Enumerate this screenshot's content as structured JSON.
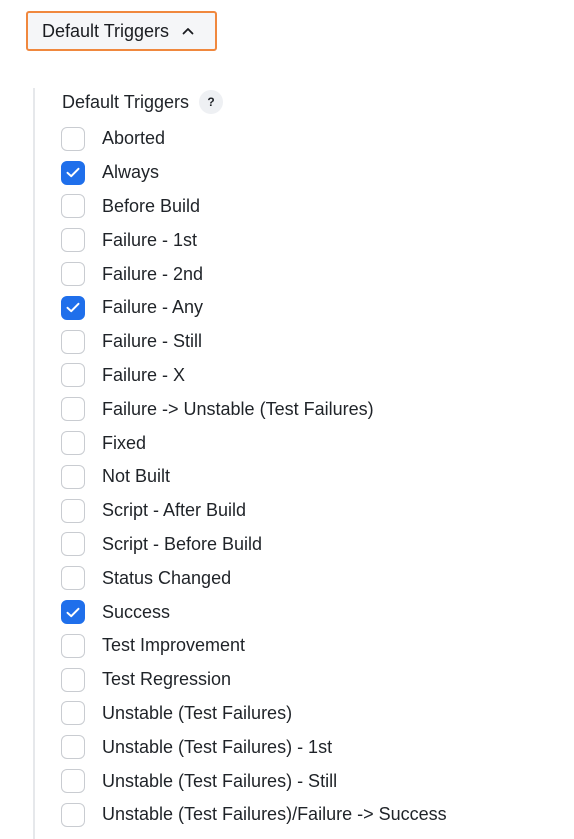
{
  "toggle": {
    "label": "Default Triggers",
    "expanded": true
  },
  "section": {
    "title": "Default Triggers",
    "help_label": "?"
  },
  "triggers": [
    {
      "label": "Aborted",
      "checked": false
    },
    {
      "label": "Always",
      "checked": true
    },
    {
      "label": "Before Build",
      "checked": false
    },
    {
      "label": "Failure - 1st",
      "checked": false
    },
    {
      "label": "Failure - 2nd",
      "checked": false
    },
    {
      "label": "Failure - Any",
      "checked": true
    },
    {
      "label": "Failure - Still",
      "checked": false
    },
    {
      "label": "Failure - X",
      "checked": false
    },
    {
      "label": "Failure -> Unstable (Test Failures)",
      "checked": false
    },
    {
      "label": "Fixed",
      "checked": false
    },
    {
      "label": "Not Built",
      "checked": false
    },
    {
      "label": "Script - After Build",
      "checked": false
    },
    {
      "label": "Script - Before Build",
      "checked": false
    },
    {
      "label": "Status Changed",
      "checked": false
    },
    {
      "label": "Success",
      "checked": true
    },
    {
      "label": "Test Improvement",
      "checked": false
    },
    {
      "label": "Test Regression",
      "checked": false
    },
    {
      "label": "Unstable (Test Failures)",
      "checked": false
    },
    {
      "label": "Unstable (Test Failures) - 1st",
      "checked": false
    },
    {
      "label": "Unstable (Test Failures) - Still",
      "checked": false
    },
    {
      "label": "Unstable (Test Failures)/Failure -> Success",
      "checked": false
    }
  ],
  "colors": {
    "focus_outline": "#f0883e",
    "checkbox_checked": "#1f6feb"
  }
}
